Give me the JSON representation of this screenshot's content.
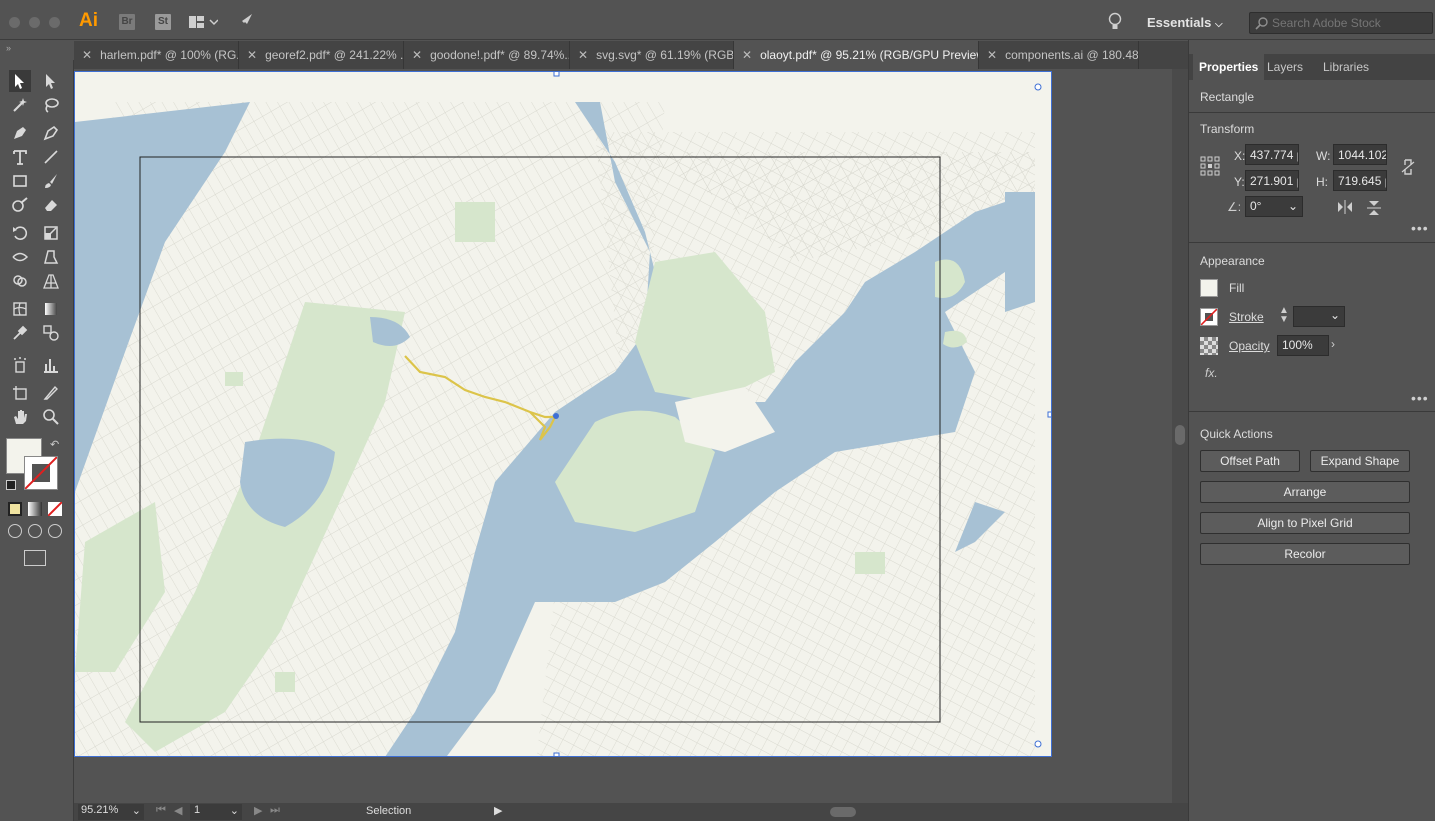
{
  "app": {
    "logo": "Ai",
    "bridge": "Br",
    "stock_app": "St"
  },
  "header": {
    "workspace": "Essentials",
    "search_placeholder": "Search Adobe Stock"
  },
  "tabs": [
    {
      "label": "harlem.pdf* @ 100% (RG..."
    },
    {
      "label": "georef2.pdf* @ 241.22% ..."
    },
    {
      "label": "goodone!.pdf* @ 89.74%..."
    },
    {
      "label": "svg.svg* @ 61.19% (RGB..."
    },
    {
      "label": "olaoyt.pdf* @ 95.21% (RGB/GPU Preview)"
    },
    {
      "label": "components.ai @ 180.48..."
    }
  ],
  "panel": {
    "tabs": [
      "Properties",
      "Layers",
      "Libraries"
    ],
    "object_type": "Rectangle",
    "transform": {
      "title": "Transform",
      "x_label": "X:",
      "x": "437.774 p",
      "y_label": "Y:",
      "y": "271.901 p",
      "w_label": "W:",
      "w": "1044.102",
      "h_label": "H:",
      "h": "719.645 p",
      "angle": "0°"
    },
    "appearance": {
      "title": "Appearance",
      "fill": "Fill",
      "stroke": "Stroke",
      "opacity_label": "Opacity",
      "opacity": "100%",
      "fx": "fx."
    },
    "quick_actions": {
      "title": "Quick Actions",
      "offset_path": "Offset Path",
      "expand_shape": "Expand Shape",
      "arrange": "Arrange",
      "align_pixel_grid": "Align to Pixel Grid",
      "recolor": "Recolor"
    }
  },
  "status": {
    "zoom": "95.21%",
    "artboard": "1",
    "tool": "Selection"
  },
  "colors": {
    "water": "#a7c1d4",
    "park": "#d6e6cc",
    "land": "#f3f3ec",
    "route": "#dcc44a",
    "selection": "#3e6fd4"
  }
}
